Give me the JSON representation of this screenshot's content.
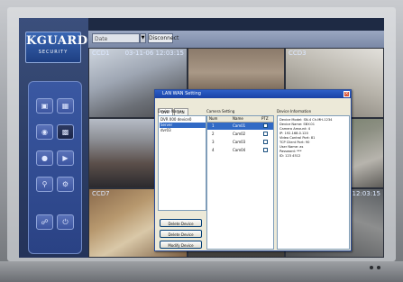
{
  "app": {
    "logo_text": "KGUARD",
    "logo_subtext": "SECURITY"
  },
  "toolbar": {
    "date_field": "Date",
    "disconnect_label": "Disconnect"
  },
  "tiles": [
    {
      "cam": "CCD1",
      "ts": "03-11-06 12:03:15"
    },
    {
      "cam": "",
      "ts": ""
    },
    {
      "cam": "CCD3",
      "ts": ""
    },
    {
      "cam": "",
      "ts": ""
    },
    {
      "cam": "",
      "ts": ""
    },
    {
      "cam": "",
      "ts": ""
    },
    {
      "cam": "CCD7",
      "ts": "03-1"
    },
    {
      "cam": "",
      "ts": ""
    },
    {
      "cam": "",
      "ts": "12:03:15"
    }
  ],
  "dialog": {
    "title": "LAN WAN Setting",
    "tabs": [
      "DVR",
      "LAN"
    ],
    "device_name_label": "Device Name",
    "device_list": [
      "DVR 000 device0",
      "Server",
      "dvr03"
    ],
    "camera_setting_label": "Camera Setting",
    "camera_headers": [
      "Num",
      "Name",
      "PTZ"
    ],
    "cameras": [
      {
        "num": "1",
        "name": "Cam01"
      },
      {
        "num": "2",
        "name": "Cam02"
      },
      {
        "num": "3",
        "name": "Cam03"
      },
      {
        "num": "4",
        "name": "Cam04"
      }
    ],
    "device_info_label": "Device Information",
    "device_info": [
      "Device Model: SN-4 Ch.MH-1234",
      "Device Name: SNY-01",
      "Camera Amount: 4",
      "IP: 192.168.0.120",
      "Video Control Port: 81",
      "TCP Client Port: 90",
      "User Name: as",
      "Password: ***",
      "ID: 123 4512"
    ],
    "buttons": [
      "Delete Device",
      "Delete Device",
      "Modify Device"
    ]
  },
  "colors": {
    "screen_bg": "#1e2a44",
    "panel_bg": "#2b3c63",
    "titlebar": "#2d5fc8",
    "selection": "#316ac5"
  },
  "icons": {
    "control_buttons": [
      "camera-icon",
      "split-icon",
      "zoom-icon",
      "grid-icon",
      "record-icon",
      "playback-icon",
      "search-icon",
      "settings-icon",
      "network-icon",
      "exit-icon"
    ]
  }
}
